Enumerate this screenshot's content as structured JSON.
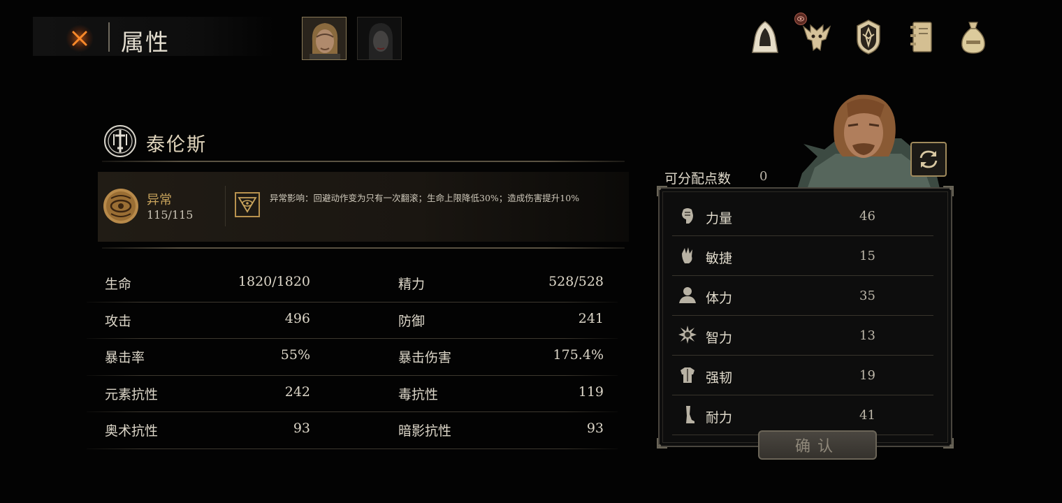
{
  "header": {
    "title": "属性",
    "badge_icon": "eye-badge-icon"
  },
  "character": {
    "name": "泰伦斯"
  },
  "abnormal": {
    "label": "异常",
    "value": "115/115",
    "effect": "异常影响：回避动作变为只有一次翻滚；生命上限降低30%；造成伤害提升10%"
  },
  "stats": [
    {
      "label1": "生命",
      "value1": "1820/1820",
      "label2": "精力",
      "value2": "528/528"
    },
    {
      "label1": "攻击",
      "value1": "496",
      "label2": "防御",
      "value2": "241"
    },
    {
      "label1": "暴击率",
      "value1": "55%",
      "label2": "暴击伤害",
      "value2": "175.4%"
    },
    {
      "label1": "元素抗性",
      "value1": "242",
      "label2": "毒抗性",
      "value2": "119"
    },
    {
      "label1": "奥术抗性",
      "value1": "93",
      "label2": "暗影抗性",
      "value2": "93"
    }
  ],
  "attributes": {
    "points_label": "可分配点数",
    "points_value": "0",
    "items": [
      {
        "label": "力量",
        "value": "46"
      },
      {
        "label": "敏捷",
        "value": "15"
      },
      {
        "label": "体力",
        "value": "35"
      },
      {
        "label": "智力",
        "value": "13"
      },
      {
        "label": "强韧",
        "value": "19"
      },
      {
        "label": "耐力",
        "value": "41"
      }
    ],
    "confirm_label": "确认"
  },
  "colors": {
    "accent_gold": "#c9a45c",
    "close_orange": "#ff7a1a"
  }
}
